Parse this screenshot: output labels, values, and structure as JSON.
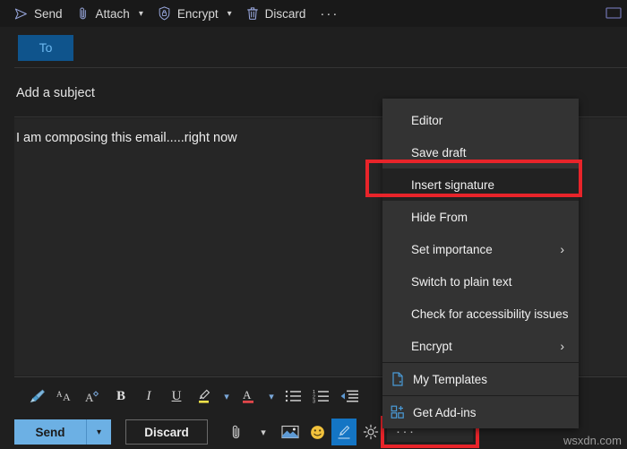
{
  "window": {
    "popout_icon": "popout-window-icon"
  },
  "toolbar": {
    "items": [
      {
        "label": "Send",
        "icon": "send-arrow-icon",
        "caret": false
      },
      {
        "label": "Attach",
        "icon": "paperclip-icon",
        "caret": true
      },
      {
        "label": "Encrypt",
        "icon": "shield-lock-icon",
        "caret": true
      },
      {
        "label": "Discard",
        "icon": "trash-icon",
        "caret": false
      }
    ],
    "overflow_label": "···"
  },
  "compose": {
    "to_label": "To",
    "subject_placeholder": "Add a subject",
    "body_text": "I am composing this email.....right now"
  },
  "format_toolbar": {
    "items": [
      {
        "name": "format-painter-icon",
        "glyph": "brush"
      },
      {
        "name": "decrease-font-size-icon",
        "glyph": "AA"
      },
      {
        "name": "increase-font-size-icon",
        "glyph": "A"
      },
      {
        "name": "bold-icon",
        "glyph": "B"
      },
      {
        "name": "italic-icon",
        "glyph": "I"
      },
      {
        "name": "underline-icon",
        "glyph": "U"
      },
      {
        "name": "highlight-color-icon",
        "glyph": "pen"
      },
      {
        "name": "font-color-icon",
        "glyph": "A-underline"
      },
      {
        "name": "bulleted-list-icon",
        "glyph": "list"
      },
      {
        "name": "numbered-list-icon",
        "glyph": "numlist"
      },
      {
        "name": "decrease-indent-icon",
        "glyph": "outdent"
      }
    ]
  },
  "actions": {
    "send_label": "Send",
    "send_caret": "⌄",
    "discard_label": "Discard",
    "icons": [
      {
        "name": "attach-file-icon"
      },
      {
        "name": "attach-dropdown-caret-icon"
      },
      {
        "name": "insert-picture-icon"
      },
      {
        "name": "emoji-icon"
      },
      {
        "name": "signature-icon"
      },
      {
        "name": "loop-components-icon"
      }
    ],
    "more_options_label": "···"
  },
  "context_menu": {
    "items": [
      {
        "label": "Editor",
        "submenu": false,
        "icon": null
      },
      {
        "label": "Save draft",
        "submenu": false,
        "icon": null
      },
      {
        "label": "Insert signature",
        "submenu": false,
        "icon": null,
        "highlighted": true
      },
      {
        "label": "Hide From",
        "submenu": false,
        "icon": null
      },
      {
        "label": "Set importance",
        "submenu": true,
        "icon": null
      },
      {
        "label": "Switch to plain text",
        "submenu": false,
        "icon": null
      },
      {
        "label": "Check for accessibility issues",
        "submenu": false,
        "icon": null
      },
      {
        "label": "Encrypt",
        "submenu": true,
        "icon": null
      },
      {
        "label": "My Templates",
        "submenu": false,
        "icon": "document-template-icon",
        "separator_before": true
      },
      {
        "label": "Get Add-ins",
        "submenu": false,
        "icon": "add-ins-grid-icon",
        "separator_before": true
      }
    ]
  },
  "annotations": {
    "accent_red": "#e8242a",
    "send_blue": "#6cb0e4",
    "to_blue": "#0f548c",
    "menu_bg": "#333333"
  },
  "watermark": {
    "text": "wsxdn.com"
  }
}
